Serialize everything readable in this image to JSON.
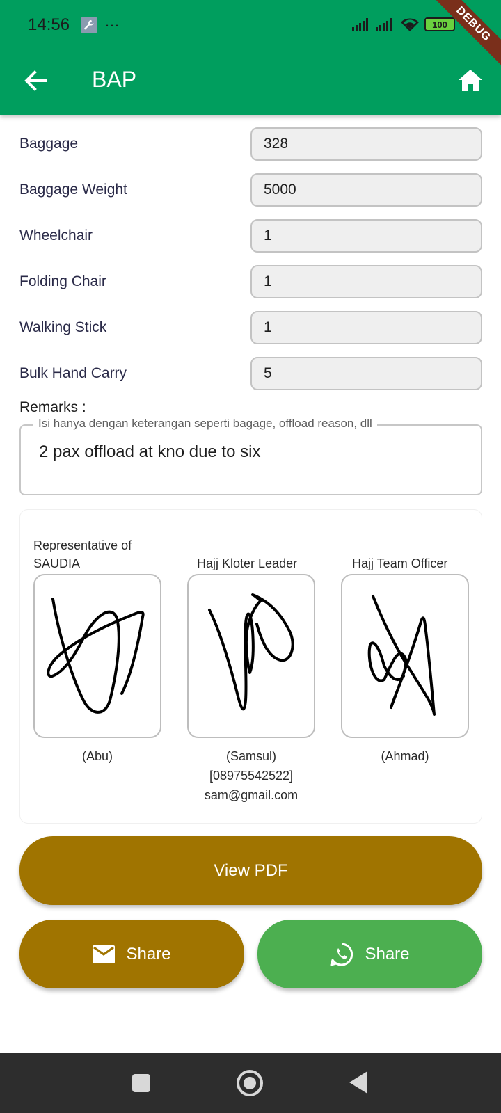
{
  "status_bar": {
    "time": "14:56",
    "more": "…",
    "battery": "100"
  },
  "debug_banner": "DEBUG",
  "app_bar": {
    "title": "BAP"
  },
  "fields": [
    {
      "label": "Baggage",
      "value": "328"
    },
    {
      "label": "Baggage Weight",
      "value": "5000"
    },
    {
      "label": "Wheelchair",
      "value": "1"
    },
    {
      "label": "Folding Chair",
      "value": "1"
    },
    {
      "label": "Walking Stick",
      "value": "1"
    },
    {
      "label": "Bulk Hand Carry",
      "value": "5"
    }
  ],
  "remarks": {
    "label": "Remarks :",
    "placeholder": "Isi hanya dengan keterangan seperti bagage, offload reason, dll",
    "value": "2 pax offload at kno due to six"
  },
  "signatures": [
    {
      "title_line1": "Representative of",
      "title_line2": "SAUDIA",
      "name": "(Abu)",
      "phone": "",
      "email": ""
    },
    {
      "title_line1": "",
      "title_line2": "Hajj Kloter Leader",
      "name": "(Samsul)",
      "phone": "[08975542522]",
      "email": "sam@gmail.com"
    },
    {
      "title_line1": "",
      "title_line2": "Hajj Team Officer",
      "name": "(Ahmad)",
      "phone": "",
      "email": ""
    }
  ],
  "buttons": {
    "view_pdf": "View PDF",
    "share_email": "Share",
    "share_whatsapp": "Share"
  },
  "colors": {
    "primary": "#009e5e",
    "gold_button": "#a07400",
    "whatsapp_button": "#4caf50",
    "nav_bar": "#2d2d2d"
  }
}
